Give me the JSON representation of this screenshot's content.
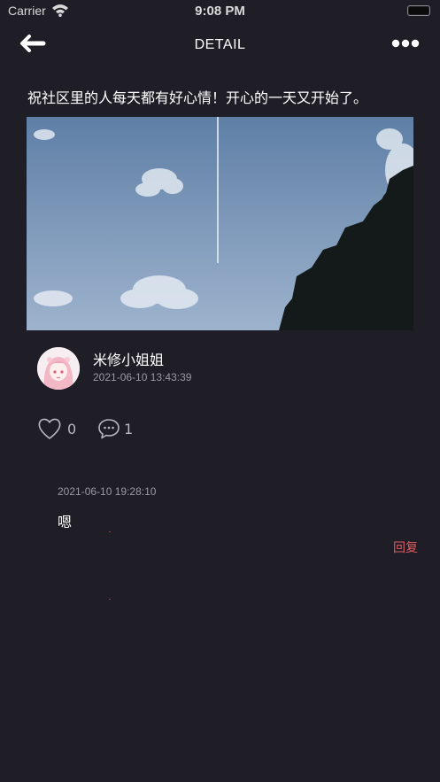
{
  "status_bar": {
    "carrier": "Carrier",
    "time": "9:08 PM"
  },
  "nav": {
    "title": "DETAIL",
    "back_icon": "arrow-left-icon",
    "more_icon": "ellipsis-icon"
  },
  "post": {
    "text": "祝社区里的人每天都有好心情！开心的一天又开始了。",
    "image": "sky-with-contrail-and-tree-photo"
  },
  "author": {
    "name": "米修小姐姐",
    "time": "2021-06-10 13:43:39",
    "avatar": "anime-girl-avatar"
  },
  "actions": {
    "likes": "0",
    "comments": "1",
    "like_icon": "heart-icon",
    "comment_icon": "chat-bubble-icon"
  },
  "comments": [
    {
      "time": "2021-06-10 19:28:10",
      "text": "嗯",
      "reply_label": "回复"
    }
  ],
  "colors": {
    "background": "#1f1e27",
    "accent": "#e05a5f",
    "muted": "#9a9aa3"
  }
}
